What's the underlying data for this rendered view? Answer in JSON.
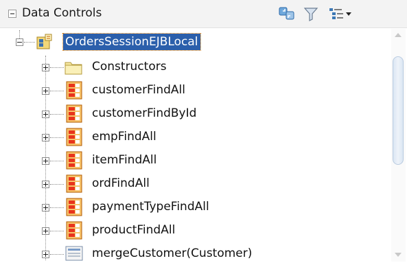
{
  "panel": {
    "title": "Data Controls",
    "toolbar": {
      "refresh_icon": "refresh-icon",
      "filter_icon": "filter-icon",
      "view_options_icon": "tree-options-icon"
    }
  },
  "tree": {
    "root": {
      "label": "OrdersSessionEJBLocal",
      "icon": "session-bean-icon",
      "expanded": true,
      "selected": true
    },
    "children": [
      {
        "label": "Constructors",
        "icon": "folder-icon"
      },
      {
        "label": "customerFindAll",
        "icon": "collection-icon"
      },
      {
        "label": "customerFindById",
        "icon": "collection-icon"
      },
      {
        "label": "empFindAll",
        "icon": "collection-icon"
      },
      {
        "label": "itemFindAll",
        "icon": "collection-icon"
      },
      {
        "label": "ordFindAll",
        "icon": "collection-icon"
      },
      {
        "label": "paymentTypeFindAll",
        "icon": "collection-icon"
      },
      {
        "label": "productFindAll",
        "icon": "collection-icon"
      },
      {
        "label": "mergeCustomer(Customer)",
        "icon": "method-icon"
      }
    ]
  }
}
